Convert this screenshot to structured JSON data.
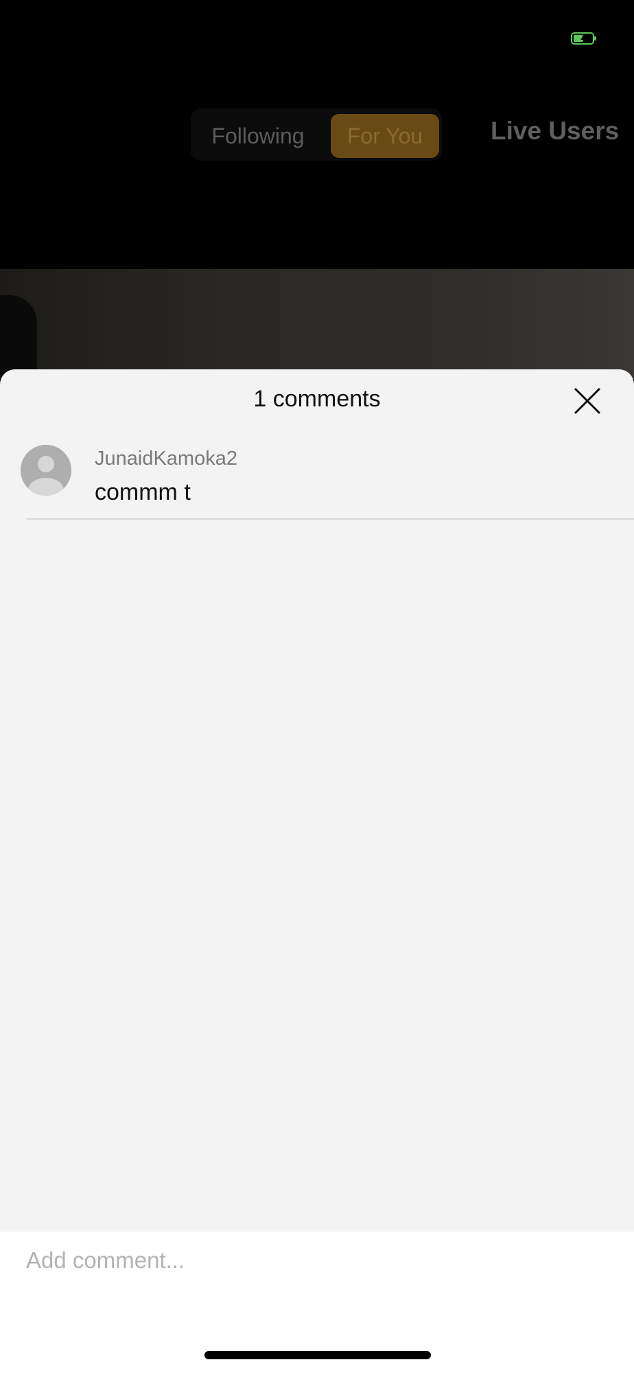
{
  "status_bar": {
    "battery_icon": "battery-charging-icon",
    "battery_color": "#5ac85a"
  },
  "header": {
    "tabs": [
      {
        "label": "Following",
        "active": false
      },
      {
        "label": "For You",
        "active": true
      }
    ],
    "live_users_label": "Live Users",
    "accent_color": "#c8891f"
  },
  "comments_sheet": {
    "title": "1 comments",
    "close_icon": "close-icon",
    "comments": [
      {
        "avatar_icon": "default-avatar-icon",
        "username": "JunaidKamoka2",
        "text": "commm t"
      }
    ]
  },
  "composer": {
    "value": "",
    "placeholder": "Add comment..."
  }
}
